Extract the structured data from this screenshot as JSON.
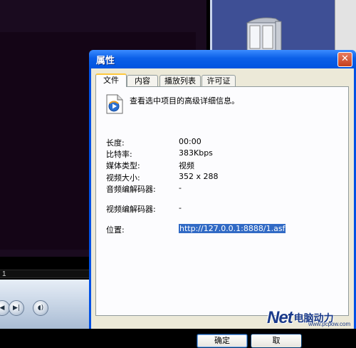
{
  "player": {
    "seek_text": "1"
  },
  "dialog": {
    "title": "属性",
    "close_glyph": "✕",
    "tabs": [
      {
        "label": "文件",
        "active": true
      },
      {
        "label": "内容",
        "active": false
      },
      {
        "label": "播放列表",
        "active": false
      },
      {
        "label": "许可证",
        "active": false
      }
    ],
    "intro": "查看选中项目的高级详细信息。",
    "properties": [
      {
        "label": "长度:",
        "value": "00:00"
      },
      {
        "label": "比特率:",
        "value": "383Kbps"
      },
      {
        "label": "媒体类型:",
        "value": "视频"
      },
      {
        "label": "视频大小:",
        "value": "352 x 288"
      },
      {
        "label": "音频编解码器:",
        "value": "-"
      },
      {
        "label": "视频编解码器:",
        "value": "-"
      },
      {
        "label": "位置:",
        "value": "http://127.0.0.1:8888/1.asf"
      }
    ],
    "ok_label": "确定",
    "cancel_label": "取"
  },
  "watermark": {
    "brand": "Net",
    "cn_text": "电脑动力",
    "url": "www.pcpow.com"
  },
  "colors": {
    "titlebar": "#0054e0",
    "dialog_bg": "#ece9d8",
    "selection": "#316ac5",
    "tab_highlight": "#ffc83c"
  },
  "icons": {
    "file_icon": "media-file-icon",
    "film_icon": "film-strip-icon"
  }
}
